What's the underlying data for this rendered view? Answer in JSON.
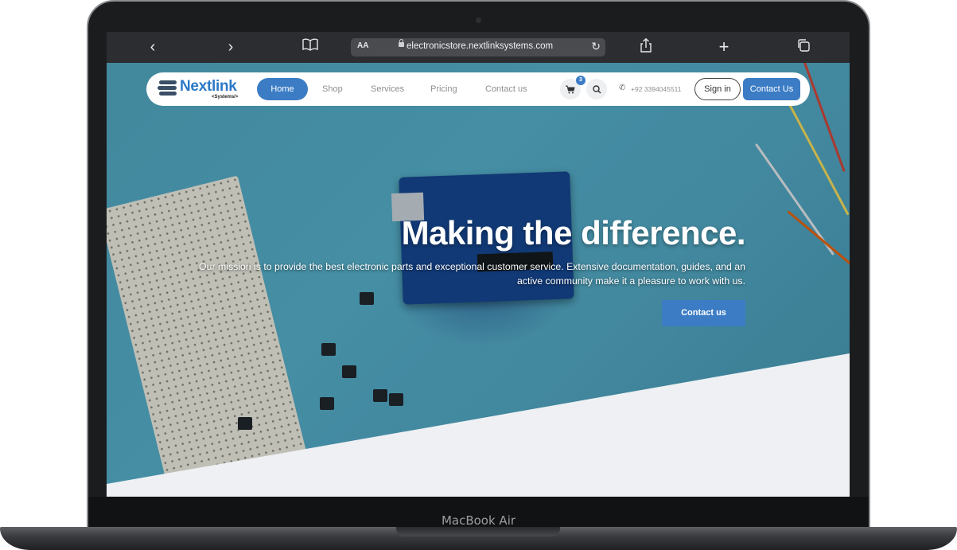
{
  "device": {
    "label": "MacBook Air"
  },
  "browser": {
    "back_icon": "chevron-left-icon",
    "forward_icon": "chevron-right-icon",
    "reader_label": "AA",
    "url": "electronicstore.nextlinksystems.com"
  },
  "nav": {
    "logo_text": "Nextlink",
    "logo_sub": "<Systems/>",
    "items": [
      {
        "label": "Home"
      },
      {
        "label": "Shop"
      },
      {
        "label": "Services"
      },
      {
        "label": "Pricing"
      },
      {
        "label": "Contact us"
      }
    ],
    "cart_count": "3",
    "phone": "+92 3394045511",
    "signin_label": "Sign in",
    "contact_label": "Contact Us"
  },
  "hero": {
    "headline": "Making the difference.",
    "subtext": "Our mission is to provide the best electronic parts and exceptional customer service. Extensive documentation, guides, and an active community make it a pleasure to work with us.",
    "cta_label": "Contact us"
  },
  "colors": {
    "accent": "#3b7cc5",
    "hero_bg": "#4a94a8",
    "bottom_panel": "#eef0f3"
  }
}
